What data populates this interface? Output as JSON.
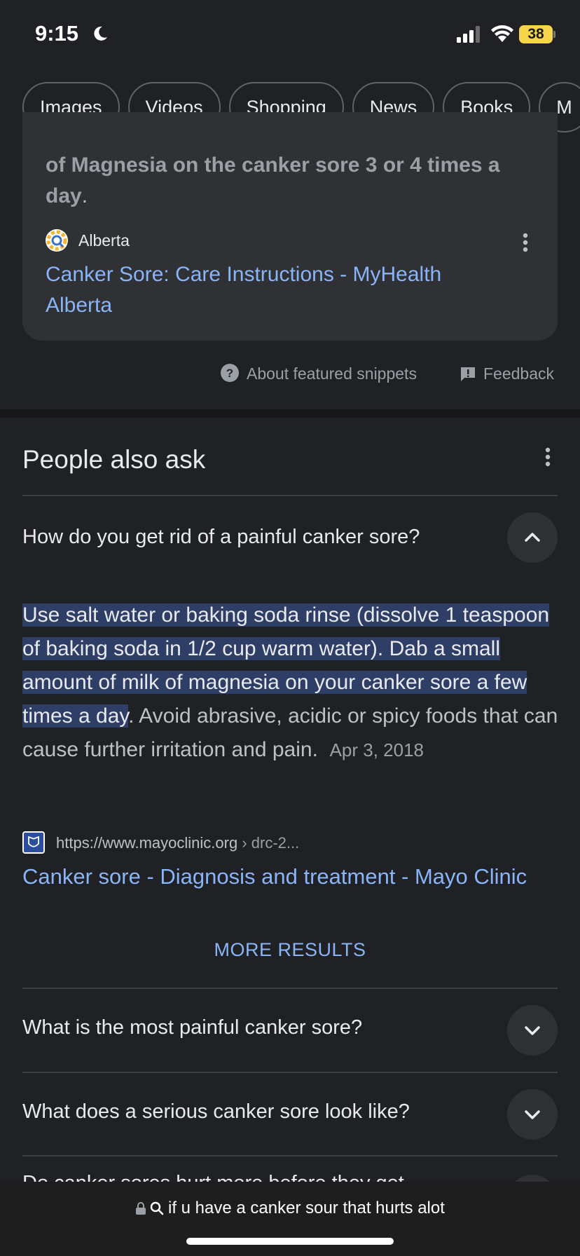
{
  "status_bar": {
    "time": "9:15",
    "battery": "38"
  },
  "chips": [
    "Images",
    "Videos",
    "Shopping",
    "News",
    "Books",
    "M"
  ],
  "featured_snippet": {
    "text_bold": "of Magnesia on the canker sore 3 or 4 times a day",
    "text_tail": ".",
    "source_name": "Alberta",
    "link_title": "Canker Sore: Care Instructions - MyHealth Alberta",
    "about": "About featured snippets",
    "feedback": "Feedback"
  },
  "people_also_ask": {
    "title": "People also ask",
    "expanded": {
      "question": "How do you get rid of a painful canker sore?",
      "answer_highlighted": "Use salt water or baking soda rinse (dissolve 1 teaspoon of baking soda in 1/2 cup warm water). Dab a small amount of milk of magnesia on your canker sore a few times a day",
      "answer_rest": ". Avoid abrasive, acidic or spicy foods that can cause further irritation and pain.",
      "date": "Apr 3, 2018",
      "url_domain": "https://www.mayoclinic.org",
      "url_path": " › drc-2...",
      "link_title": "Canker sore - Diagnosis and treatment - Mayo Clinic",
      "more_results": "MORE RESULTS"
    },
    "questions": [
      "What is the most painful canker sore?",
      "What does a serious canker sore look like?",
      "Do canker sores hurt more before they get"
    ]
  },
  "address_bar": {
    "query": "if u have a canker sour that hurts alot"
  },
  "colors": {
    "background": "#202124",
    "card": "#303134",
    "link": "#8ab4f8",
    "highlight": "#2f3e66",
    "battery": "#f6d54c"
  }
}
